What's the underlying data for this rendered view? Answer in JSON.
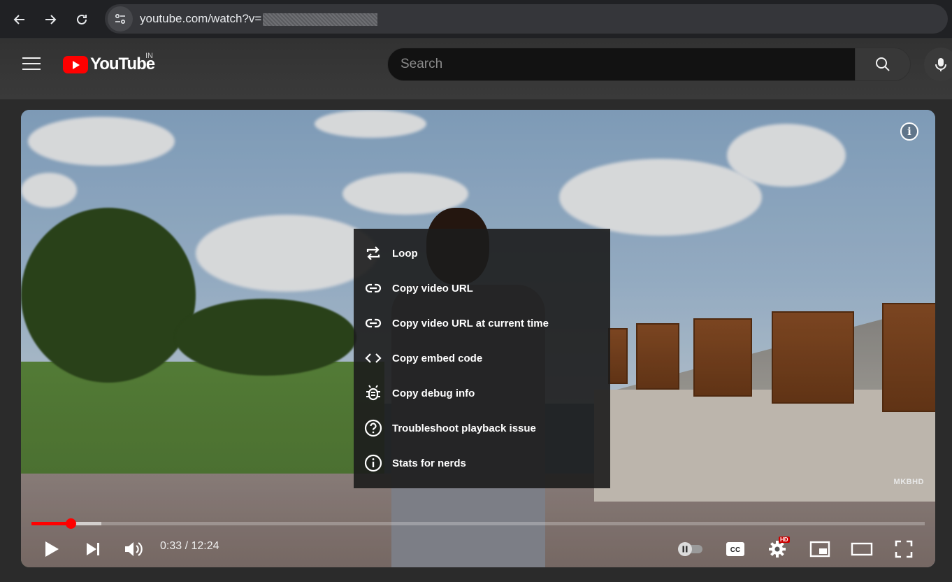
{
  "browser": {
    "url_visible": "youtube.com/watch?v="
  },
  "header": {
    "logo_text": "YouTube",
    "region": "IN",
    "search_placeholder": "Search"
  },
  "player": {
    "watermark": "MKBHD",
    "context_menu": [
      {
        "label": "Loop",
        "icon": "loop-icon"
      },
      {
        "label": "Copy video URL",
        "icon": "link-icon"
      },
      {
        "label": "Copy video URL at current time",
        "icon": "link-icon"
      },
      {
        "label": "Copy embed code",
        "icon": "code-icon"
      },
      {
        "label": "Copy debug info",
        "icon": "bug-icon"
      },
      {
        "label": "Troubleshoot playback issue",
        "icon": "help-icon"
      },
      {
        "label": "Stats for nerds",
        "icon": "info-icon"
      }
    ],
    "current_time": "0:33",
    "duration": "12:24",
    "time_display": "0:33 / 12:24",
    "progress_fraction": 0.044,
    "settings_badge": "HD"
  },
  "colors": {
    "brand_red": "#ff0000",
    "menu_bg": "#1c1c1c"
  }
}
